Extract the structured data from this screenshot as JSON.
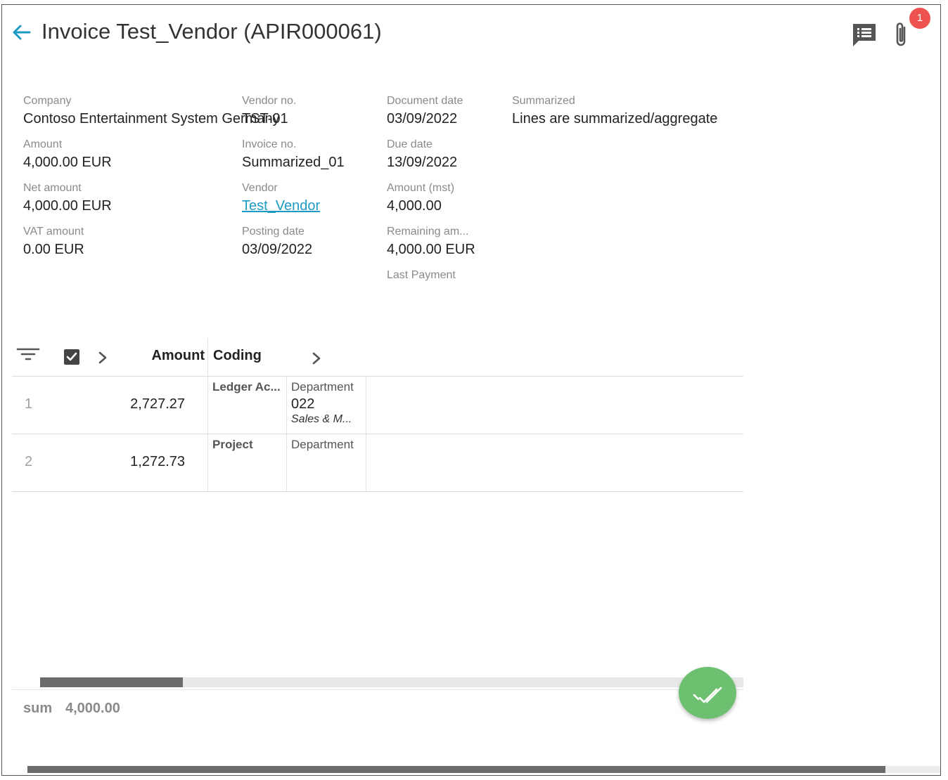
{
  "header": {
    "title": "Invoice Test_Vendor (APIR000061)",
    "attachment_count": "1"
  },
  "fields": {
    "company": {
      "label": "Company",
      "value": "Contoso Entertainment System Germany"
    },
    "amount": {
      "label": "Amount",
      "value": "4,000.00 EUR"
    },
    "net_amount": {
      "label": "Net amount",
      "value": "4,000.00 EUR"
    },
    "vat_amount": {
      "label": "VAT amount",
      "value": "0.00 EUR"
    },
    "vendor_no": {
      "label": "Vendor no.",
      "value": "TST-01"
    },
    "invoice_no": {
      "label": "Invoice no.",
      "value": "Summarized_01"
    },
    "vendor": {
      "label": "Vendor",
      "value": "Test_Vendor"
    },
    "posting_date": {
      "label": "Posting date",
      "value": "03/09/2022"
    },
    "document_date": {
      "label": "Document date",
      "value": "03/09/2022"
    },
    "due_date": {
      "label": "Due date",
      "value": "13/09/2022"
    },
    "amount_mst": {
      "label": "Amount (mst)",
      "value": "4,000.00"
    },
    "remaining_amount": {
      "label": "Remaining am...",
      "value": "4,000.00 EUR"
    },
    "last_payment": {
      "label": "Last Payment",
      "value": ""
    },
    "summarized": {
      "label": "Summarized",
      "value": "Lines are summarized/aggregate"
    }
  },
  "grid": {
    "columns": {
      "amount": "Amount",
      "coding": "Coding"
    },
    "rows": [
      {
        "num": "1",
        "amount": "2,727.27",
        "col1_head": "Ledger Ac...",
        "col2_head": "Department",
        "col2_value": "022",
        "col2_sub": "Sales & M..."
      },
      {
        "num": "2",
        "amount": "1,272.73",
        "col1_head": "Project",
        "col2_head": "Department"
      }
    ]
  },
  "footer": {
    "sum_label": "sum",
    "sum_value": "4,000.00"
  },
  "colors": {
    "accent": "#1e9bc4",
    "approve_fab": "#6cc06f",
    "badge": "#ef5350"
  },
  "icons": [
    "back-arrow-icon",
    "comment-icon",
    "paperclip-icon",
    "filter-icon",
    "checkbox-icon",
    "chevron-right-icon",
    "double-check-icon"
  ]
}
